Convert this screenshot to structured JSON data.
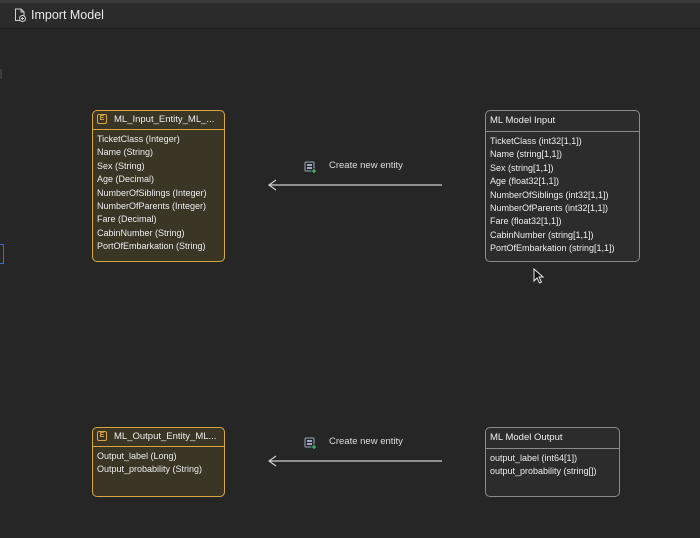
{
  "window": {
    "title": "Import Model",
    "title_icon": "document-import-icon"
  },
  "mappings": [
    {
      "entity": {
        "title": "ML_Input_Entity_ML_...",
        "icon_letter": "E",
        "attributes": [
          "TicketClass (Integer)",
          "Name (String)",
          "Sex (String)",
          "Age (Decimal)",
          "NumberOfSiblings (Integer)",
          "NumberOfParents (Integer)",
          "Fare (Decimal)",
          "CabinNumber (String)",
          "PortOfEmbarkation (String)"
        ]
      },
      "action_label": "Create new entity",
      "model": {
        "title": "ML Model Input",
        "attributes": [
          "TicketClass (int32[1,1])",
          "Name (string[1,1])",
          "Sex (string[1,1])",
          "Age (float32[1,1])",
          "NumberOfSiblings (int32[1,1])",
          "NumberOfParents (int32[1,1])",
          "Fare (float32[1,1])",
          "CabinNumber (string[1,1])",
          "PortOfEmbarkation (string[1,1])"
        ]
      }
    },
    {
      "entity": {
        "title": "ML_Output_Entity_ML...",
        "icon_letter": "E",
        "attributes": [
          "Output_label (Long)",
          "Output_probability (String)"
        ]
      },
      "action_label": "Create new entity",
      "model": {
        "title": "ML Model Output",
        "attributes": [
          "output_label (int64[1])",
          "output_probability (string[])"
        ]
      }
    }
  ],
  "colors": {
    "entity_border": "#d8a73f",
    "entity_fill": "#3a3524",
    "model_border": "#8a8a8a",
    "background": "#262626",
    "create_icon_accent": "#3fbf6a"
  }
}
